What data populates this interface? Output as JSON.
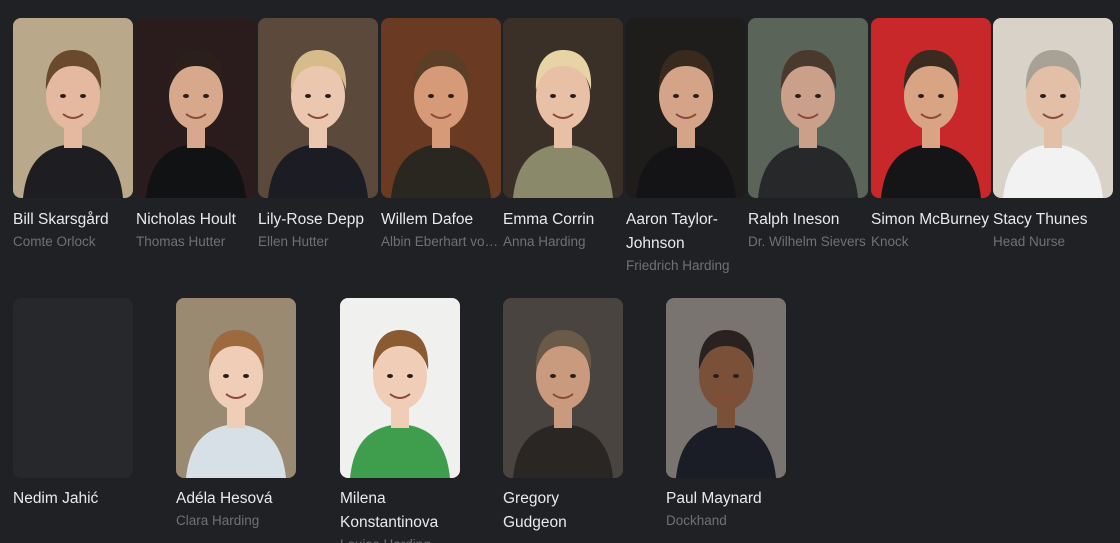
{
  "cast": [
    {
      "name": "Bill Skarsgård",
      "role": "Comte Orlock",
      "bg": "#b9a98a",
      "shirt": "#1e1e22",
      "skin": "#e4b9a0",
      "hair": "#6a4a2c"
    },
    {
      "name": "Nicholas Hoult",
      "role": "Thomas Hutter",
      "bg": "#2a1c1c",
      "shirt": "#111214",
      "skin": "#d8a88c",
      "hair": "#2a1f1a"
    },
    {
      "name": "Lily-Rose Depp",
      "role": "Ellen Hutter",
      "bg": "#5b4a3c",
      "shirt": "#1c1c24",
      "skin": "#ecc7b0",
      "hair": "#d7bb8a"
    },
    {
      "name": "Willem Dafoe",
      "role": "Albin Eberhart von Franz",
      "bg": "#6a3a22",
      "shirt": "#2a2620",
      "skin": "#d69a78",
      "hair": "#5a3e26"
    },
    {
      "name": "Emma Corrin",
      "role": "Anna Harding",
      "bg": "#3a3028",
      "shirt": "#8a8a6a",
      "skin": "#e8c0a6",
      "hair": "#e6d3a6"
    },
    {
      "name": "Aaron Taylor-Johnson",
      "role": "Friedrich Harding",
      "bg": "#1f1c1c",
      "shirt": "#141416",
      "skin": "#d5a488",
      "hair": "#3a2a1e"
    },
    {
      "name": "Ralph Ineson",
      "role": "Dr. Wilhelm Sievers",
      "bg": "#5a6458",
      "shirt": "#26282a",
      "skin": "#caa08a",
      "hair": "#4a3a2e"
    },
    {
      "name": "Simon McBurney",
      "role": "Knock",
      "bg": "#c8282a",
      "shirt": "#151517",
      "skin": "#d9a484",
      "hair": "#3a2a20"
    },
    {
      "name": "Stacy Thunes",
      "role": "Head Nurse",
      "bg": "#d8d2c8",
      "shirt": "#f2f2f2",
      "skin": "#e2bfa6",
      "hair": "#a8a296"
    },
    {
      "name": "Nedim Jahić",
      "role": "",
      "empty": true
    },
    {
      "name": "Adéla Hesová",
      "role": "Clara Harding",
      "bg": "#9a8a72",
      "shirt": "#d6e0e6",
      "skin": "#f0cdb6",
      "hair": "#9c6a3e"
    },
    {
      "name": "Milena Konstantinova",
      "role": "Louise Harding",
      "bg": "#f0f0ee",
      "shirt": "#3f9e4e",
      "skin": "#f0cdb6",
      "hair": "#8a5a30"
    },
    {
      "name": "Gregory Gudgeon",
      "role": "",
      "bg": "#4a4440",
      "shirt": "#2a2624",
      "skin": "#c99a7e",
      "hair": "#6a5a48"
    },
    {
      "name": "Paul Maynard",
      "role": "Dockhand",
      "bg": "#7a7470",
      "shirt": "#1a1c26",
      "skin": "#7a5038",
      "hair": "#2a2220"
    }
  ]
}
